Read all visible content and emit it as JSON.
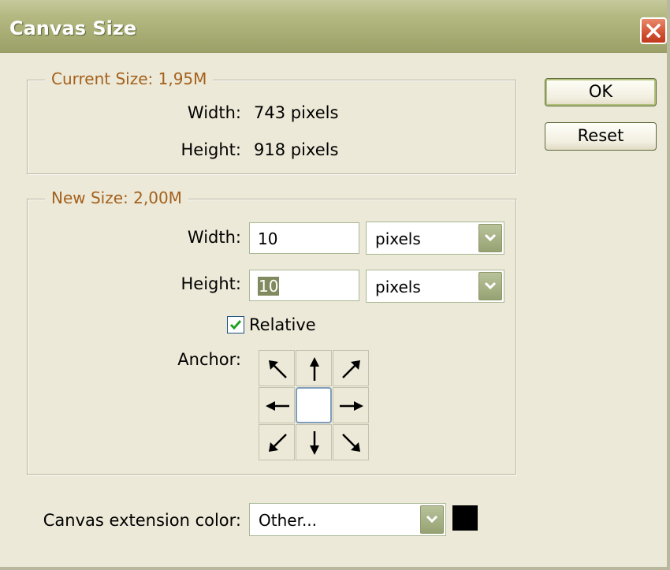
{
  "window": {
    "title": "Canvas Size"
  },
  "current_size": {
    "legend": "Current Size: 1,95M",
    "width_label": "Width:",
    "width_value": "743 pixels",
    "height_label": "Height:",
    "height_value": "918 pixels"
  },
  "new_size": {
    "legend": "New Size: 2,00M",
    "width_label": "Width:",
    "width_value": "10",
    "width_unit": "pixels",
    "height_label": "Height:",
    "height_value": "10",
    "height_unit": "pixels",
    "relative_label": "Relative",
    "relative_checked": true,
    "anchor_label": "Anchor:",
    "anchor_icons": [
      "arrow-up-left-icon",
      "arrow-up-icon",
      "arrow-up-right-icon",
      "arrow-left-icon",
      "anchor-center",
      "arrow-right-icon",
      "arrow-down-left-icon",
      "arrow-down-icon",
      "arrow-down-right-icon"
    ]
  },
  "buttons": {
    "ok": "OK",
    "reset": "Reset"
  },
  "extension": {
    "label": "Canvas extension color:",
    "value": "Other...",
    "swatch_color": "#000000"
  },
  "colors": {
    "legend": "#a4611d",
    "title_bar": "#b4b982",
    "background": "#ece9d8"
  }
}
